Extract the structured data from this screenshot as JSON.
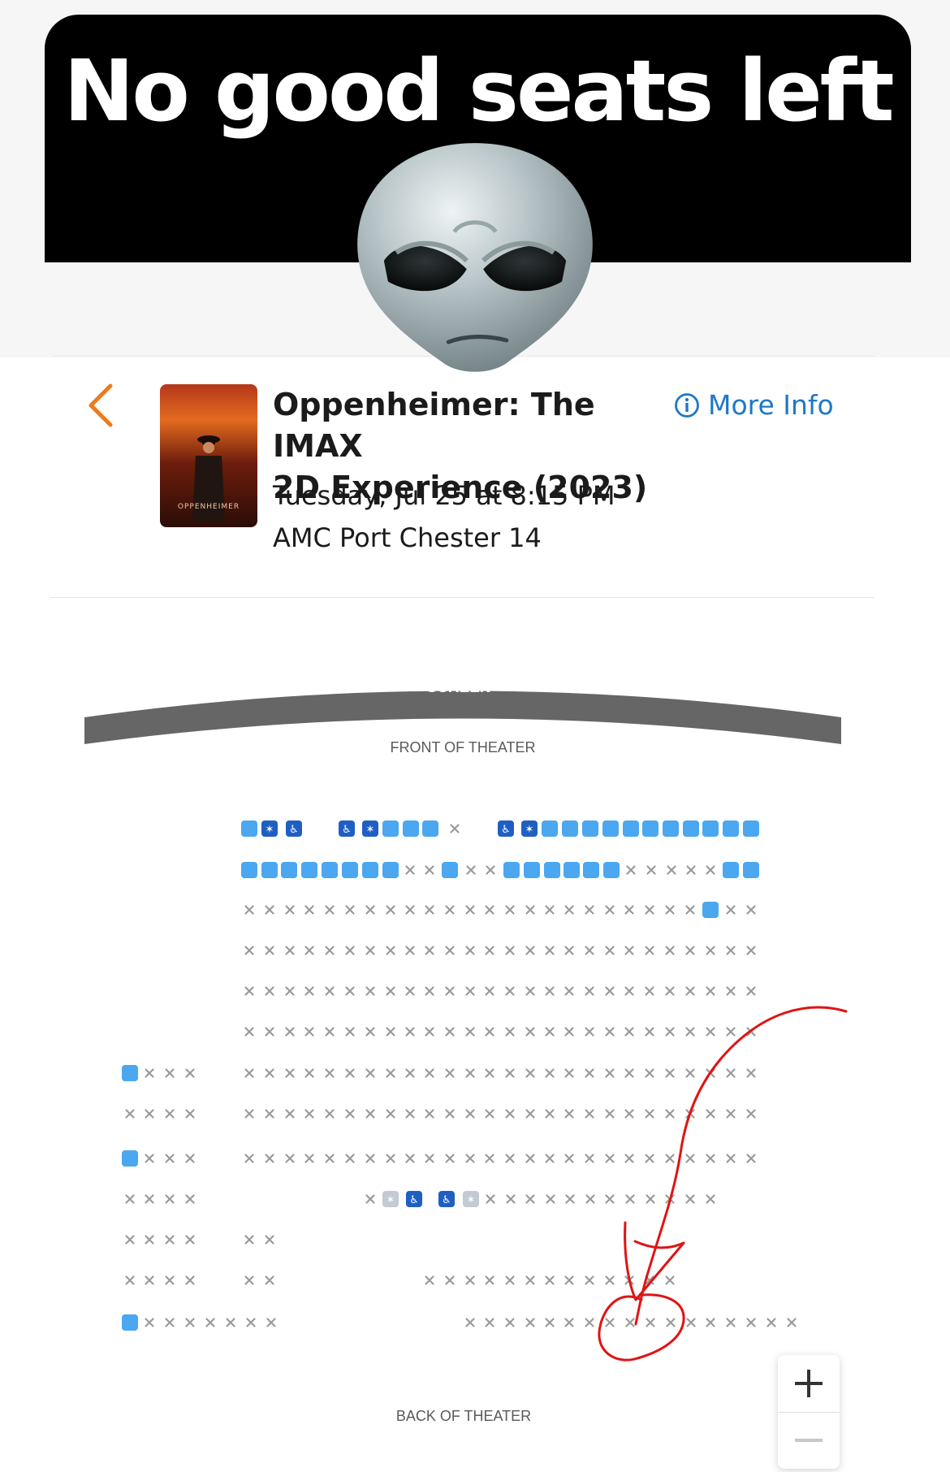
{
  "caption": {
    "text": "No good seats left"
  },
  "header": {
    "title_line1": "Oppenheimer: The IMAX",
    "title_line2": "2D Experience (2023)",
    "more_info_label": "More Info",
    "showtime": "Tuesday, Jul 25 at 8:15 PM",
    "theater": "AMC Port Chester 14",
    "poster_title": "OPPENHEIMER"
  },
  "seat_map": {
    "screen_label": "SCREEN",
    "front_label": "FRONT OF THEATER",
    "back_label": "BACK OF THEATER",
    "legend": {
      "A": "available",
      "W": "wheelchair-space",
      "C": "companion-seat",
      "G": "companion-seat-unavailable",
      "x": "taken"
    },
    "rows": [
      "A C W . W C A A A x . W C A A A A A A A A A A A A",
      "A A A A A A A A x x A x x A A A A A A x x x x x A A",
      "x x x x x x x x x x x x x x x x x x x x x x x A x x x",
      "x x x x x x x x x x x x x x x x x x x x x x x x x x x",
      "x x x x x x x x x x x x x x x x x x x x x x x x x x x",
      "x x x x x x x x x x x x x x x x x x x x x x x x x x x",
      "A x x x x x x x x x x x x x x x x x x x x x x x x x x x x x x",
      "x x x x x x x x x x x x x x x x x x x x x x x x x x x x x x x",
      "A x x x x x x x x x x x x x x x x x x x x x x x x x x x x x A",
      "x x x x x G W W G x x x x x x x x x x x x",
      "x x x x x x",
      "x x x x x x x x x x x x x x x x x x x",
      "A x x x x x x x x x x x x x x x x x x x x x x x x x"
    ]
  },
  "colors": {
    "available": "#4aa7f0",
    "wheelchair": "#1f5fc4",
    "companion_unavailable": "#c3cad3",
    "taken": "#9a9a9a",
    "accent_orange": "#f07a1a",
    "link_blue": "#1e78c8",
    "annotation_red": "#e01414"
  },
  "icons": {
    "back": "chevron-left-icon",
    "info": "info-circle-icon",
    "zoom_in": "plus-icon",
    "zoom_out": "minus-icon"
  }
}
